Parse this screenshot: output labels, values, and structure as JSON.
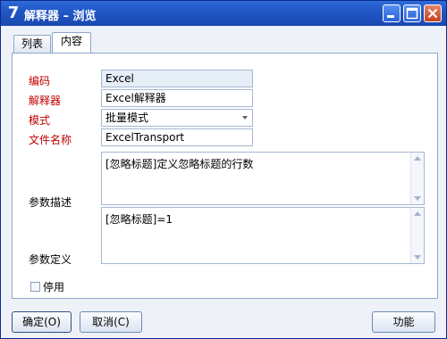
{
  "window": {
    "title": "解释器 – 浏览",
    "app_icon_glyph": "7",
    "title_color": "#2057c6"
  },
  "tabs": [
    {
      "label": "列表"
    },
    {
      "label": "内容"
    }
  ],
  "form": {
    "code_label": "编码",
    "code_value": "Excel",
    "interpreter_label": "解释器",
    "interpreter_value": "Excel解释器",
    "mode_label": "模式",
    "mode_value": "批量模式",
    "filename_label": "文件名称",
    "filename_value": "ExcelTransport",
    "param_desc_label": "参数描述",
    "param_desc_value": "[忽略标题]定义忽略标题的行数",
    "param_def_label": "参数定义",
    "param_def_value": "[忽略标题]=1",
    "disable_label": "停用",
    "disable_checked": false,
    "required_color": "#c00000"
  },
  "buttons": {
    "ok": "确定(O)",
    "cancel": "取消(C)",
    "function": "功能"
  },
  "icons": {
    "minimize": "minimize-icon",
    "maximize": "maximize-icon",
    "close": "close-icon"
  }
}
